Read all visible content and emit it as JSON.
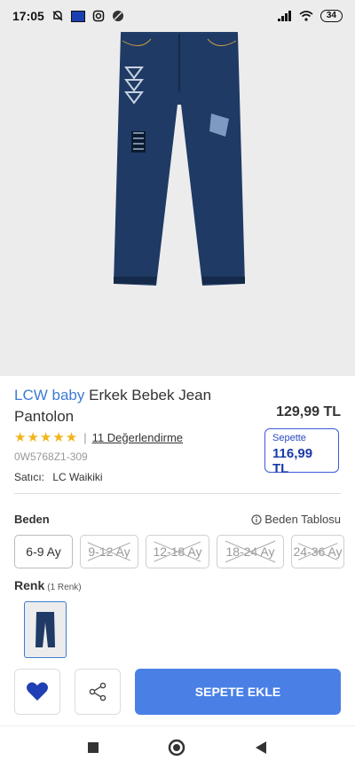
{
  "status": {
    "time": "17:05",
    "battery": "34"
  },
  "product": {
    "brand": "LCW baby",
    "name": "Erkek Bebek Jean Pantolon",
    "price": "129,99 TL",
    "cart_label": "Sepette",
    "cart_price": "116,99 TL",
    "rating_stars": "★★★★★",
    "reviews": "11 Değerlendirme",
    "sku": "0W5768Z1-309",
    "seller_label": "Satıcı:",
    "seller_name": "LC Waikiki"
  },
  "size": {
    "label": "Beden",
    "table_link": "Beden Tablosu",
    "options": [
      "6-9 Ay",
      "9-12 Ay",
      "12-18 Ay",
      "18-24 Ay",
      "24-36 Ay"
    ]
  },
  "color": {
    "label": "Renk",
    "count": "(1 Renk)"
  },
  "actions": {
    "add_to_cart": "SEPETE EKLE"
  },
  "colors": {
    "brand": "#3d7cd2",
    "button": "#4a80e6",
    "heart": "#1f3fb4",
    "stars": "#f2b418",
    "denim": "#1f3a64"
  }
}
